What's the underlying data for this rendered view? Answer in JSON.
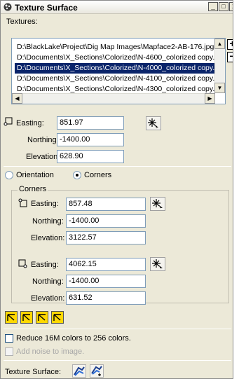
{
  "window": {
    "title": "Texture Surface",
    "minimize_glyph": "_",
    "maximize_glyph": "□",
    "close_glyph": "x"
  },
  "textures": {
    "label": "Textures:",
    "items": [
      "D:\\BlackLake\\Project\\Dig Map Images\\Mapface2-AB-176.jpg",
      "D:\\Documents\\X_Sections\\Colorized\\N-4600_colorized copy.",
      "D:\\Documents\\X_Sections\\Colorized\\N-4000_colorized copy.",
      "D:\\Documents\\X_Sections\\Colorized\\N-4100_colorized copy.",
      "D:\\Documents\\X_Sections\\Colorized\\N-4300_colorized copy."
    ],
    "selected_index": 2,
    "add_glyph": "+",
    "remove_glyph": "−",
    "scroll_up": "▲",
    "scroll_down": "▼",
    "scroll_left": "◀",
    "scroll_right": "▶"
  },
  "origin": {
    "easting_label": "Easting:",
    "easting": "851.97",
    "northing_label": "Northing:",
    "northing": "-1400.00",
    "elevation_label": "Elevation:",
    "elevation": "628.90"
  },
  "mode": {
    "orientation_label": "Orientation",
    "corners_label": "Corners",
    "selected": "corners"
  },
  "corners": {
    "group_label": "Corners",
    "top": {
      "easting_label": "Easting:",
      "easting": "857.48",
      "northing_label": "Northing:",
      "northing": "-1400.00",
      "elevation_label": "Elevation:",
      "elevation": "3122.57"
    },
    "bottom": {
      "easting_label": "Easting:",
      "easting": "4062.15",
      "northing_label": "Northing:",
      "northing": "-1400.00",
      "elevation_label": "Elevation:",
      "elevation": "631.52"
    }
  },
  "options": {
    "reduce_colors_label": "Reduce 16M colors to 256 colors.",
    "reduce_colors_checked": false,
    "add_noise_label": "Add noise to image.",
    "add_noise_checked": false
  },
  "footer": {
    "label": "Texture Surface:"
  },
  "colors": {
    "selection": "#0a246a",
    "tool_yellow": "#ffd800",
    "panel": "#ece9d8"
  }
}
